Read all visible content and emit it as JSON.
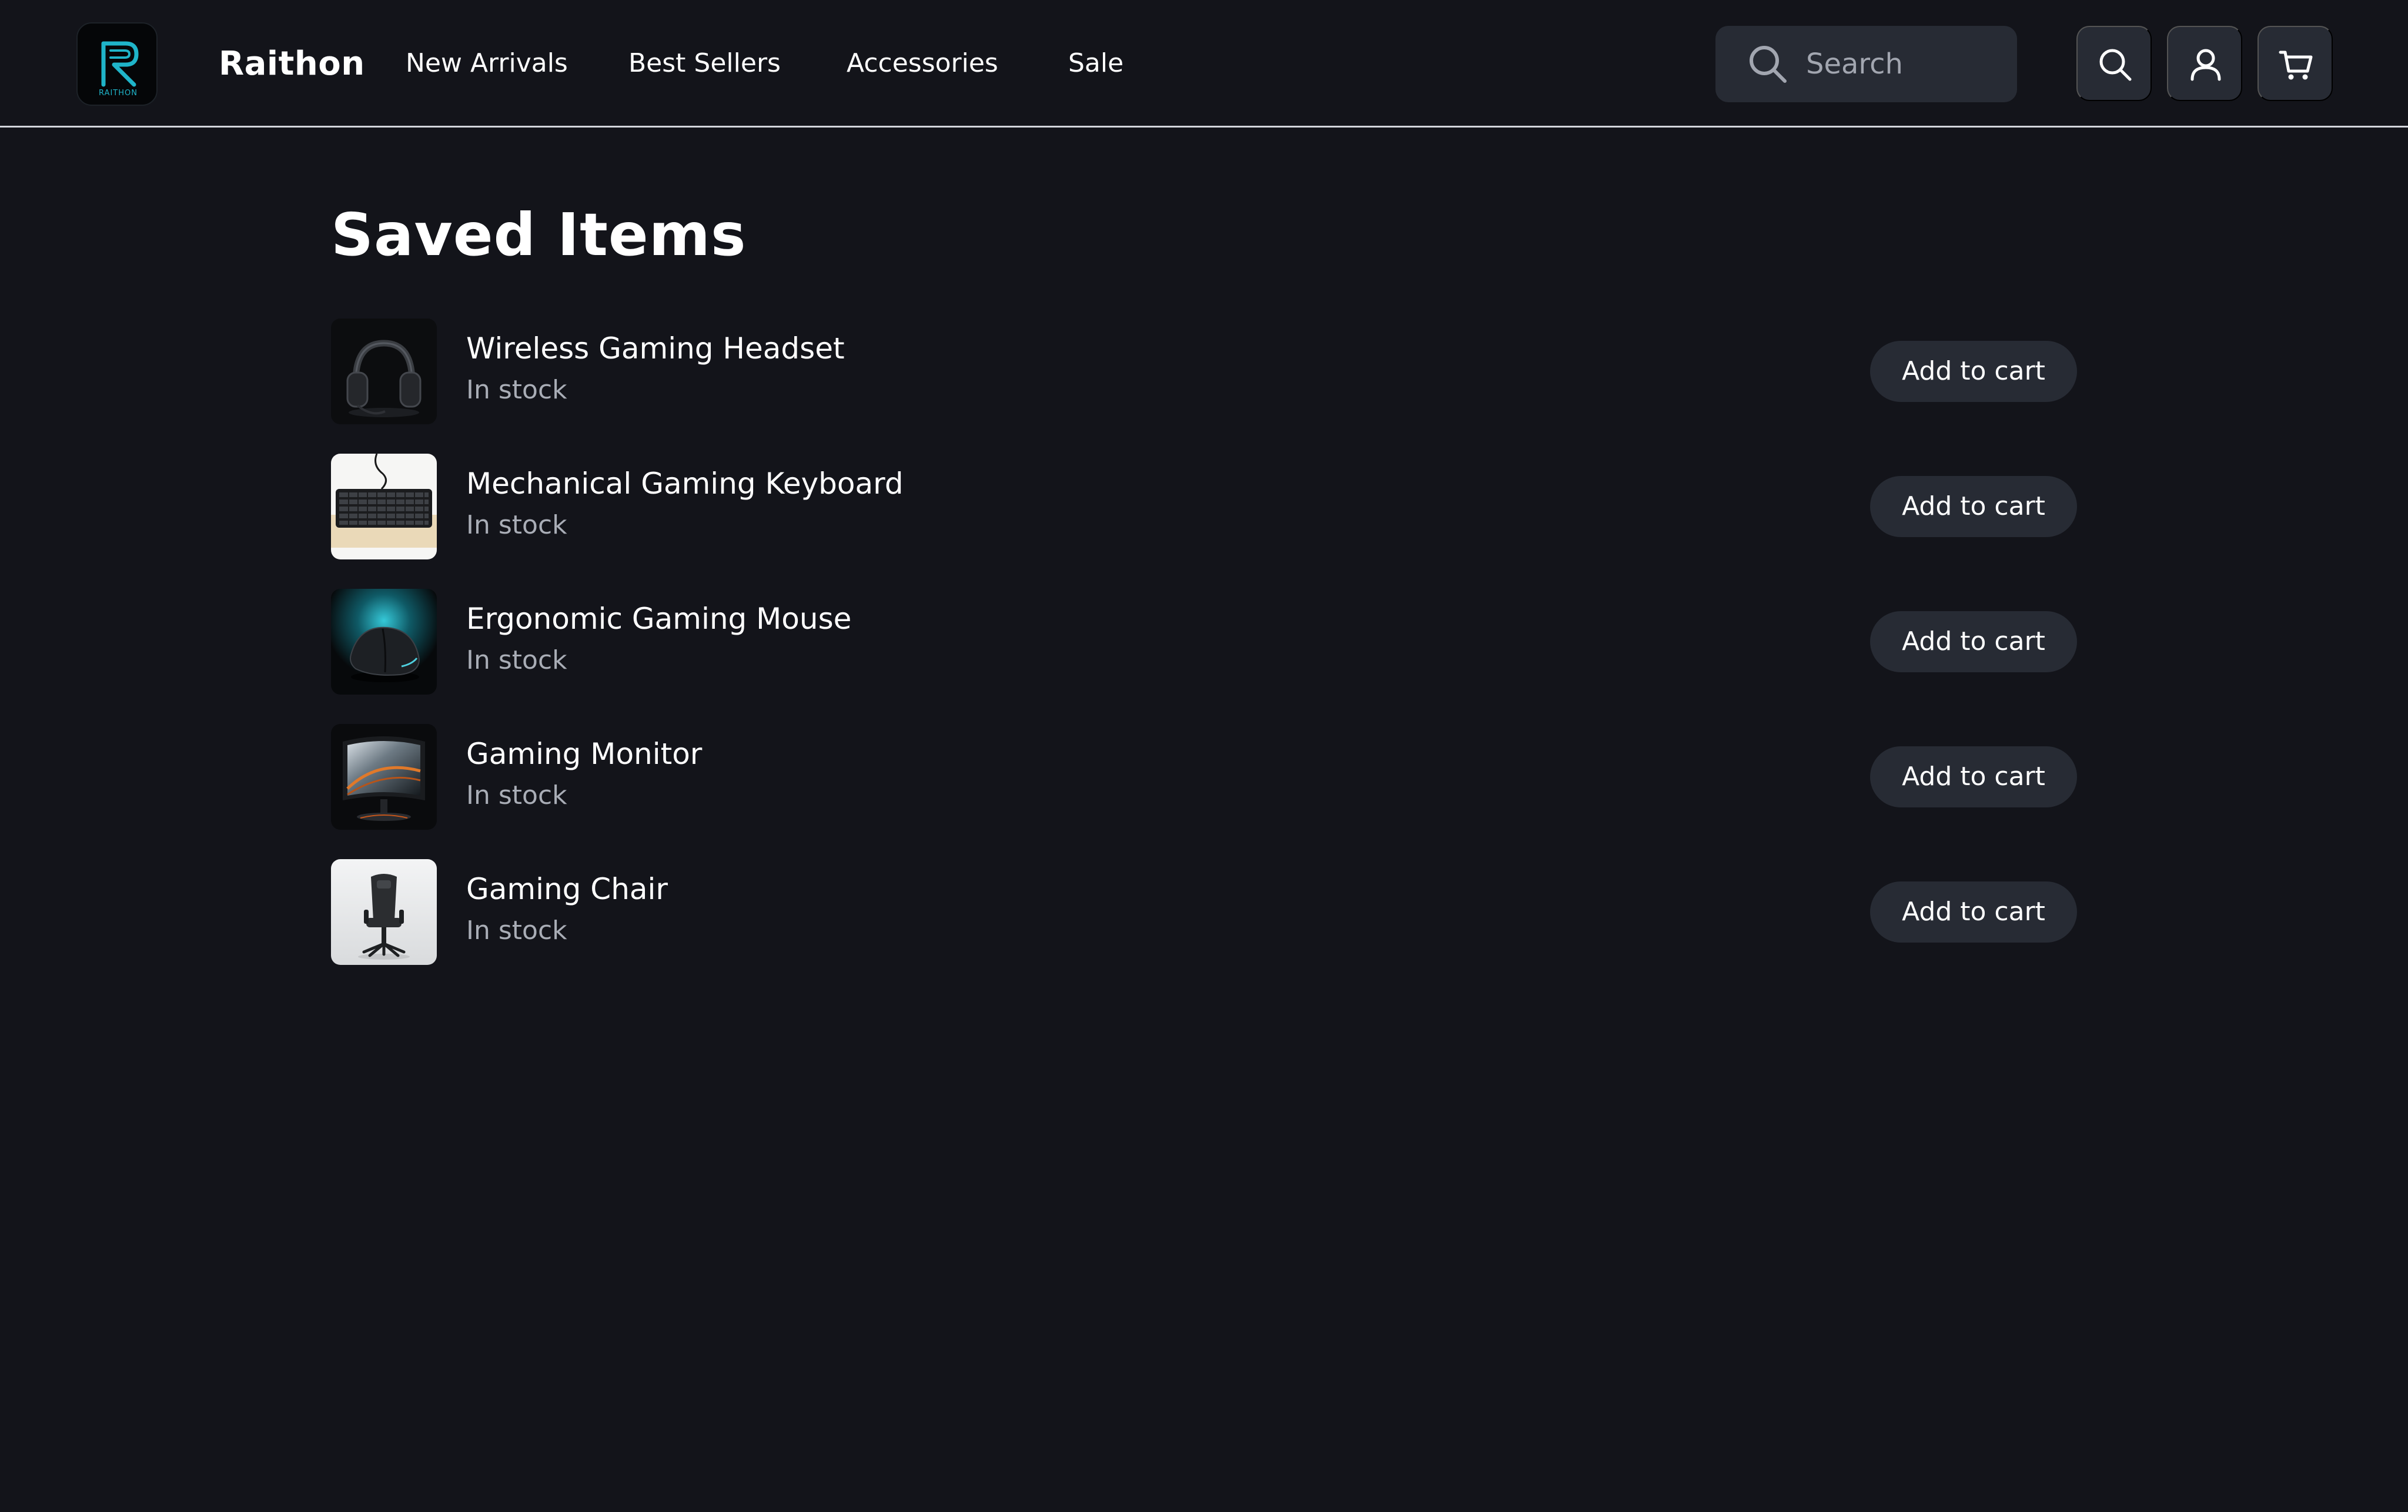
{
  "brand": {
    "name": "Raithon",
    "logo_text": "RAITHON",
    "logo_accent": "#1fb4c9"
  },
  "nav": {
    "links": [
      {
        "label": "New Arrivals"
      },
      {
        "label": "Best Sellers"
      },
      {
        "label": "Accessories"
      },
      {
        "label": "Sale"
      }
    ]
  },
  "search": {
    "placeholder": "Search",
    "value": "",
    "icon": "search-icon"
  },
  "actions": {
    "search_icon": "search-icon",
    "account_icon": "user-icon",
    "cart_icon": "cart-icon"
  },
  "page": {
    "title": "Saved Items"
  },
  "saved_items": [
    {
      "name": "Wireless Gaming Headset",
      "status": "In stock",
      "button": "Add to cart",
      "thumbnail": "headset"
    },
    {
      "name": "Mechanical Gaming Keyboard",
      "status": "In stock",
      "button": "Add to cart",
      "thumbnail": "keyboard"
    },
    {
      "name": "Ergonomic Gaming Mouse",
      "status": "In stock",
      "button": "Add to cart",
      "thumbnail": "mouse"
    },
    {
      "name": "Gaming Monitor",
      "status": "In stock",
      "button": "Add to cart",
      "thumbnail": "monitor"
    },
    {
      "name": "Gaming Chair",
      "status": "In stock",
      "button": "Add to cart",
      "thumbnail": "chair"
    }
  ],
  "colors": {
    "background": "#13141a",
    "surface": "#272b34",
    "text": "#ffffff",
    "muted_text": "#a9adb6",
    "divider": "#d4d6dc"
  }
}
